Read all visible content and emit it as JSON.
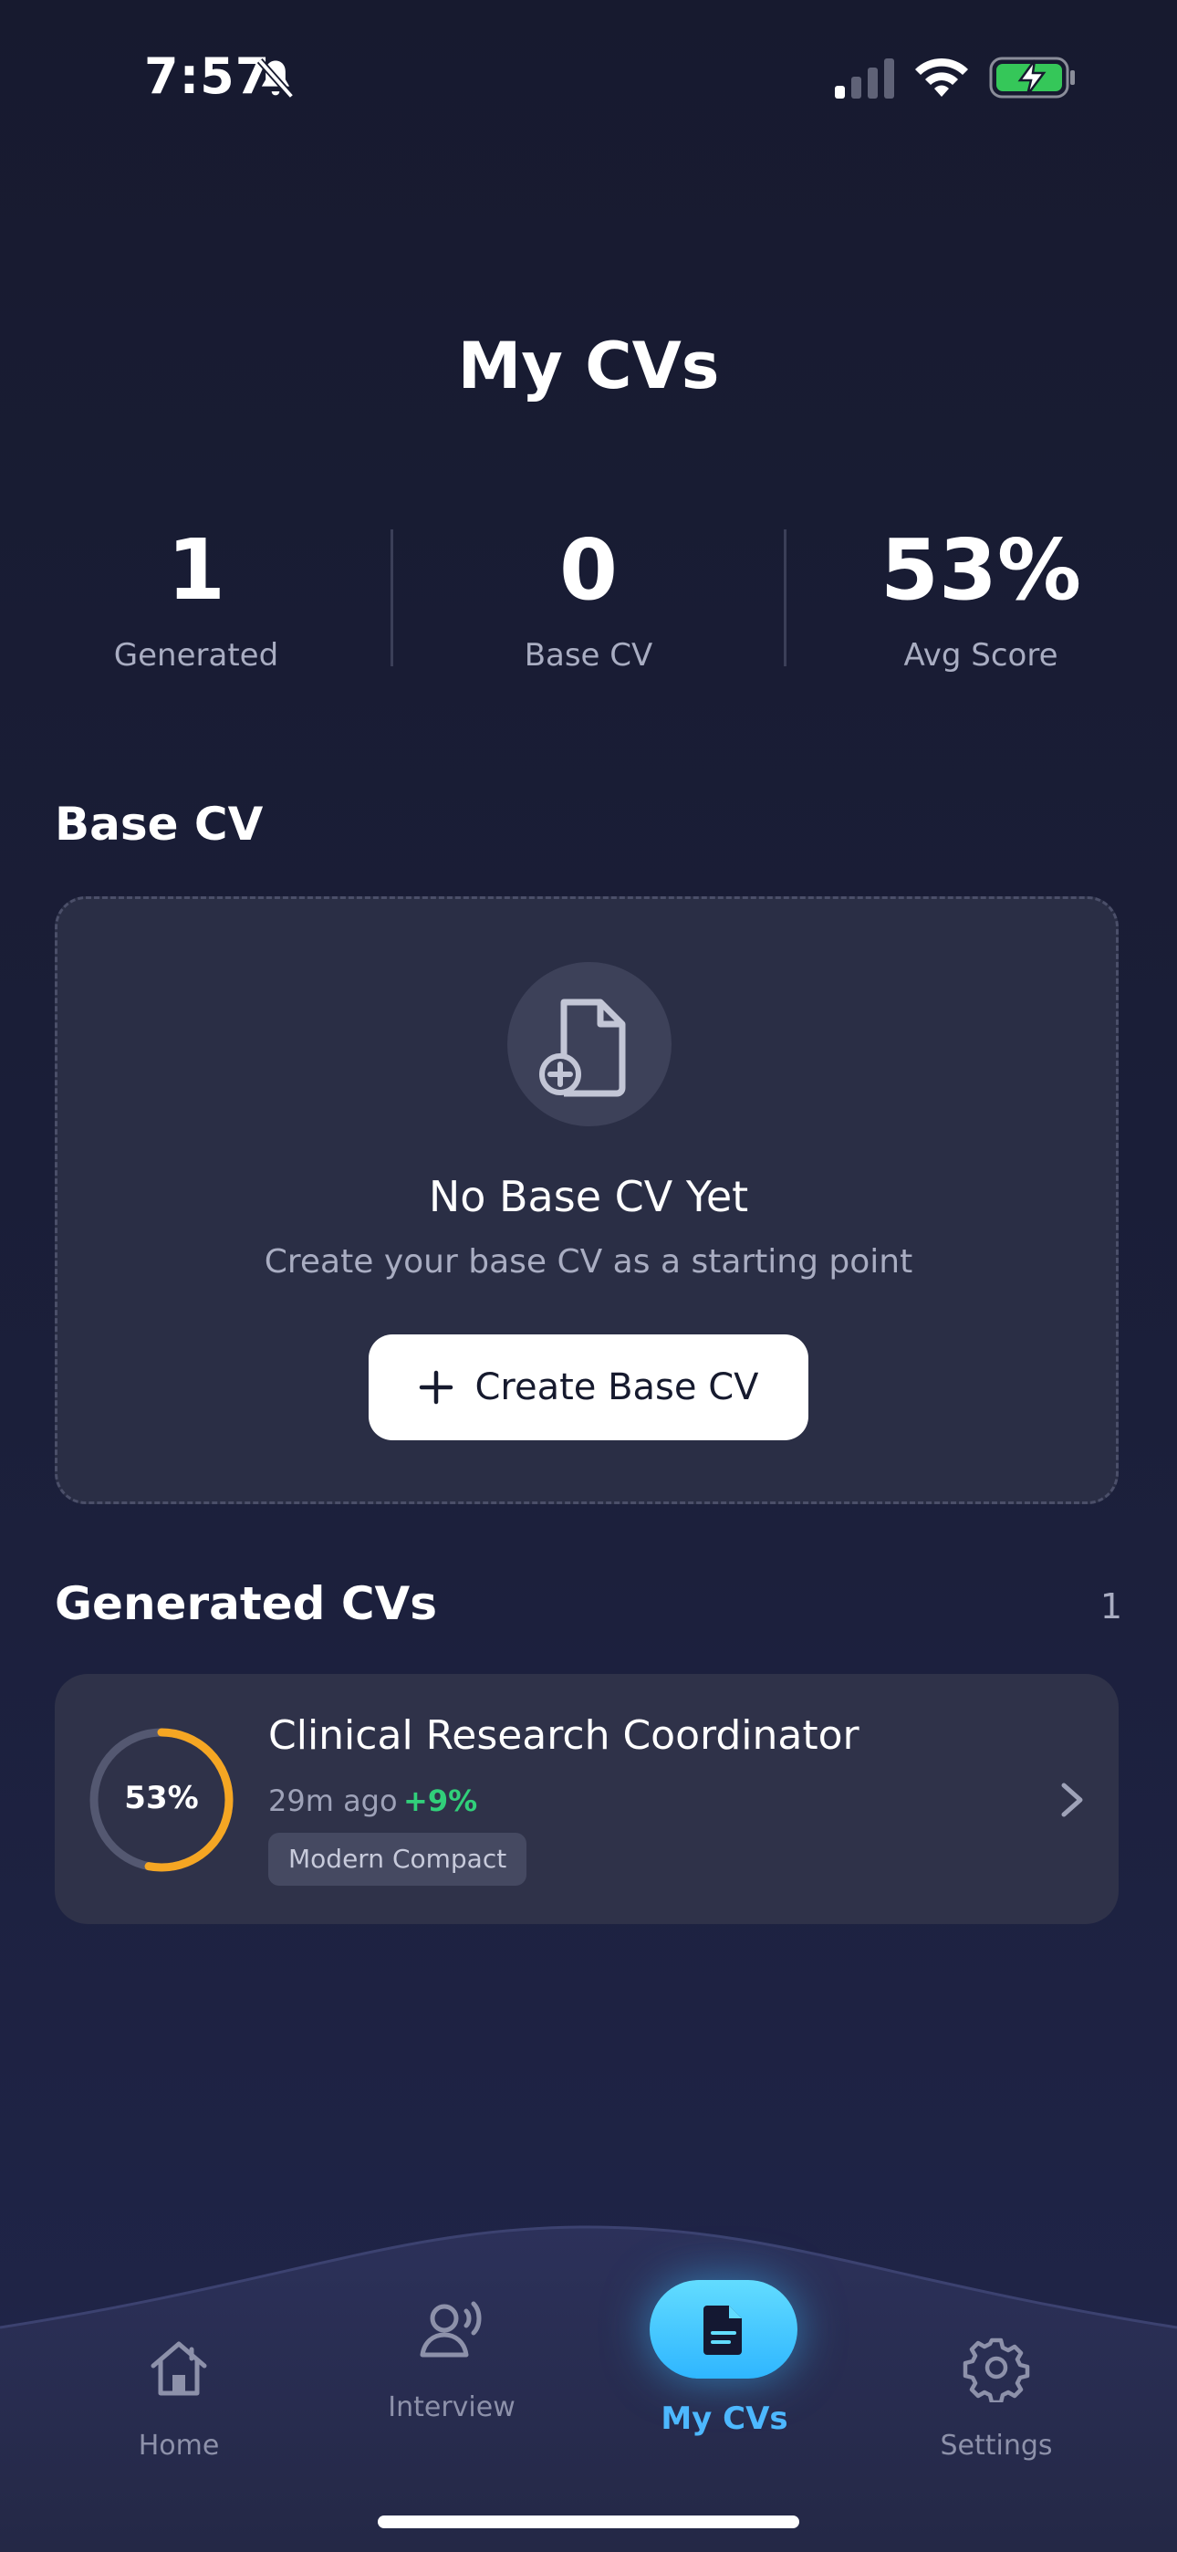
{
  "status_bar": {
    "time": "7:57",
    "icons": [
      "bell-slash-icon",
      "cellular-signal-icon",
      "wifi-icon",
      "battery-charging-icon"
    ]
  },
  "header": {
    "title": "My CVs"
  },
  "stats": [
    {
      "value": "1",
      "label": "Generated"
    },
    {
      "value": "0",
      "label": "Base CV"
    },
    {
      "value": "53%",
      "label": "Avg Score"
    }
  ],
  "base_cv": {
    "section_title": "Base CV",
    "icon": "document-add-icon",
    "empty_title": "No Base CV Yet",
    "empty_subtitle": "Create your base CV as a starting point",
    "button_label": "Create Base CV"
  },
  "generated": {
    "section_title": "Generated CVs",
    "count": "1",
    "items": [
      {
        "score_label": "53%",
        "score": 0.53,
        "title": "Clinical Research Coordinator",
        "time": "29m ago",
        "delta": "+9%",
        "template": "Modern Compact"
      }
    ]
  },
  "tabs": [
    {
      "label": "Home",
      "icon": "house-icon",
      "active": false
    },
    {
      "label": "Interview",
      "icon": "voice-person-icon",
      "active": false
    },
    {
      "label": "My CVs",
      "icon": "document-icon",
      "active": true
    },
    {
      "label": "Settings",
      "icon": "gear-icon",
      "active": false
    }
  ],
  "colors": {
    "background": "#1b1f3a",
    "card": "#2f3249",
    "accent": "#2fb6ff",
    "score_ring": "#f5a623",
    "positive": "#31d07a"
  }
}
